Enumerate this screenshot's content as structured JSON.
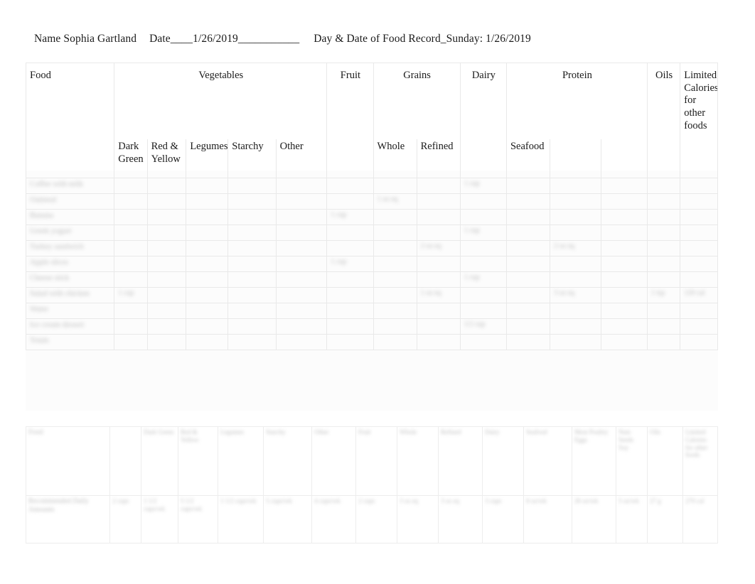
{
  "document": {
    "header": {
      "name_label": "Name",
      "name_value": "Sophia Gartland",
      "date_label": "Date____",
      "date_value": "1/26/2019",
      "date_trailing_rule": "___________",
      "record_label": "Day & Date of Food Record_Sunday: 1/26/2019"
    }
  },
  "main_table": {
    "group_headers": [
      "Food",
      "Vegetables",
      "Fruit",
      "Grains",
      "Dairy",
      "Protein",
      "Oils",
      "Limited Calories for other foods"
    ],
    "sub_headers": {
      "food": "",
      "vegetables": [
        "Dark Green",
        "Red & Yellow",
        "Legumes",
        "Starchy",
        "Other"
      ],
      "fruit": "",
      "grains": [
        "Whole",
        "Refined"
      ],
      "dairy": "",
      "protein": [
        "Seafood",
        "",
        ""
      ],
      "oils": "",
      "limited": ""
    },
    "rows": [
      {
        "food": "Coffee with milk",
        "dark_green": "",
        "red_yellow": "",
        "legumes": "",
        "starchy": "",
        "other": "",
        "fruit": "",
        "whole": "",
        "refined": "",
        "dairy": "1 cup",
        "seafood": "",
        "protein_b": "",
        "protein_c": "",
        "oils": "",
        "limited": ""
      },
      {
        "food": "Oatmeal",
        "dark_green": "",
        "red_yellow": "",
        "legumes": "",
        "starchy": "",
        "other": "",
        "fruit": "",
        "whole": "1 oz eq",
        "refined": "",
        "dairy": "",
        "seafood": "",
        "protein_b": "",
        "protein_c": "",
        "oils": "",
        "limited": ""
      },
      {
        "food": "Banana",
        "dark_green": "",
        "red_yellow": "",
        "legumes": "",
        "starchy": "",
        "other": "",
        "fruit": "1 cup",
        "whole": "",
        "refined": "",
        "dairy": "",
        "seafood": "",
        "protein_b": "",
        "protein_c": "",
        "oils": "",
        "limited": ""
      },
      {
        "food": "Greek yogurt",
        "dark_green": "",
        "red_yellow": "",
        "legumes": "",
        "starchy": "",
        "other": "",
        "fruit": "",
        "whole": "",
        "refined": "",
        "dairy": "1 cup",
        "seafood": "",
        "protein_b": "",
        "protein_c": "",
        "oils": "",
        "limited": ""
      },
      {
        "food": "Turkey sandwich",
        "dark_green": "",
        "red_yellow": "",
        "legumes": "",
        "starchy": "",
        "other": "",
        "fruit": "",
        "whole": "",
        "refined": "2 oz eq",
        "dairy": "",
        "seafood": "",
        "protein_b": "2 oz eq",
        "protein_c": "",
        "oils": "",
        "limited": ""
      },
      {
        "food": "Apple slices",
        "dark_green": "",
        "red_yellow": "",
        "legumes": "",
        "starchy": "",
        "other": "",
        "fruit": "1 cup",
        "whole": "",
        "refined": "",
        "dairy": "",
        "seafood": "",
        "protein_b": "",
        "protein_c": "",
        "oils": "",
        "limited": ""
      },
      {
        "food": "Cheese stick",
        "dark_green": "",
        "red_yellow": "",
        "legumes": "",
        "starchy": "",
        "other": "",
        "fruit": "",
        "whole": "",
        "refined": "",
        "dairy": "1 cup",
        "seafood": "",
        "protein_b": "",
        "protein_c": "",
        "oils": "",
        "limited": ""
      },
      {
        "food": "Salad with chicken",
        "dark_green": "1 cup",
        "red_yellow": "",
        "legumes": "",
        "starchy": "",
        "other": "",
        "fruit": "",
        "whole": "",
        "refined": "1 oz eq",
        "dairy": "",
        "seafood": "",
        "protein_b": "3 oz eq",
        "protein_c": "",
        "oils": "1 tsp",
        "limited": "120 cal"
      },
      {
        "food": "Water",
        "dark_green": "",
        "red_yellow": "",
        "legumes": "",
        "starchy": "",
        "other": "",
        "fruit": "",
        "whole": "",
        "refined": "",
        "dairy": "",
        "seafood": "",
        "protein_b": "",
        "protein_c": "",
        "oils": "",
        "limited": ""
      },
      {
        "food": "Ice cream dessert",
        "dark_green": "",
        "red_yellow": "",
        "legumes": "",
        "starchy": "",
        "other": "",
        "fruit": "",
        "whole": "",
        "refined": "",
        "dairy": "1/2 cup",
        "seafood": "",
        "protein_b": "",
        "protein_c": "",
        "oils": "",
        "limited": ""
      },
      {
        "food": "Totals",
        "dark_green": "",
        "red_yellow": "",
        "legumes": "",
        "starchy": "",
        "other": "",
        "fruit": "",
        "whole": "",
        "refined": "",
        "dairy": "",
        "seafood": "",
        "protein_b": "",
        "protein_c": "",
        "oils": "",
        "limited": ""
      }
    ]
  },
  "summary_table": {
    "header_row": [
      "Food",
      "",
      "Dark Green",
      "Red & Yellow",
      "Legumes",
      "Starchy",
      "Other",
      "Fruit",
      "Whole",
      "Refined",
      "Dairy",
      "Seafood",
      "Meat Poultry Eggs",
      "Nuts Seeds Soy",
      "Oils",
      "Limited Calories for other foods"
    ],
    "value_row": [
      "Recommended Daily Amounts",
      "2 cups",
      "1 1/2 cups/wk",
      "5 1/2 cups/wk",
      "1 1/2 cups/wk",
      "5 cups/wk",
      "4 cups/wk",
      "2 cups",
      "3 oz eq",
      "3 oz eq",
      "3 cups",
      "8 oz/wk",
      "26 oz/wk",
      "5 oz/wk",
      "27 g",
      "270 cal"
    ]
  }
}
